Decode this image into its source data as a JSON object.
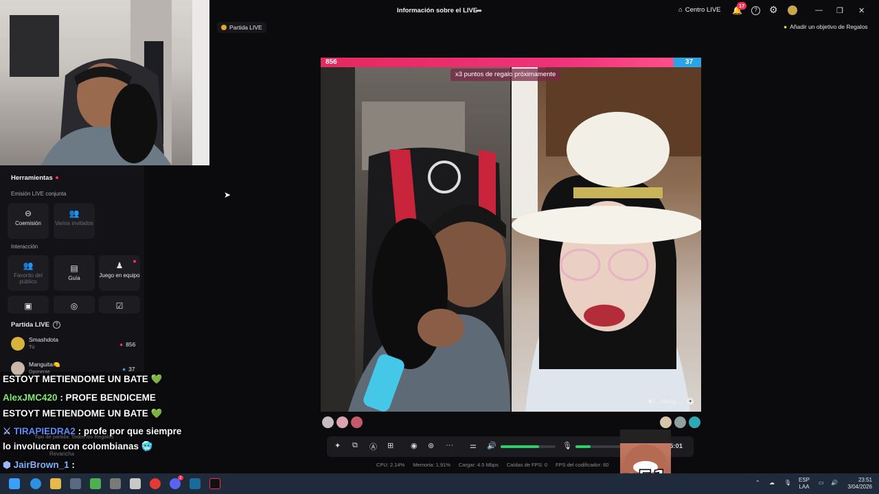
{
  "header": {
    "title": "Información sobre el LIVE",
    "centro_live": "Centro LIVE",
    "notifications_count": "17",
    "goal_label": "Añadir un objetivo de Regalos",
    "match_chip": "Partida LIVE"
  },
  "tools": {
    "title": "Herramientas",
    "section_cohost": "Emisión LIVE conjunta",
    "cohost_items": [
      {
        "label": "Coemisión",
        "enabled": true
      },
      {
        "label": "Varios invitados",
        "enabled": false
      }
    ],
    "section_interaction": "Interacción",
    "interaction_items": [
      {
        "label": "Favorito del público",
        "enabled": false
      },
      {
        "label": "Guía",
        "enabled": true
      },
      {
        "label": "Juego en equipo",
        "enabled": true
      }
    ]
  },
  "match": {
    "title": "Partida LIVE",
    "players": [
      {
        "name": "Smashdota",
        "sub": "Tú",
        "score": "856"
      },
      {
        "name": "Manguita🍋",
        "sub": "Oponente",
        "score": "37"
      }
    ],
    "match_type": "Tipo de partida: Todos los Regalos",
    "rematch": "Revancha"
  },
  "battle": {
    "score_left": "856",
    "score_right": "37",
    "banner": "x3 puntos de regalo próximamente",
    "opponent_tag": "Mang..."
  },
  "chat": [
    {
      "user": "",
      "text": "ESTOYT METIENDOME UN BATE 💚"
    },
    {
      "user": "AlexJMC420",
      "text": ": PROFE BENDICEME"
    },
    {
      "user": "",
      "text": "ESTOYT METIENDOME UN BATE 💚"
    },
    {
      "user": "TIRAPIEDRA2",
      "text": ": profe por que siempre"
    },
    {
      "user": "",
      "text": "lo involucran con colombianas 🥶"
    },
    {
      "user": "JairBrown_1",
      "text": ":"
    }
  ],
  "controls": {
    "timer": "5:01",
    "volume_level": 0.7,
    "mic_level": 0.28
  },
  "stats": [
    "CPU: 2.14%",
    "Memoria: 1.91%",
    "Cargar: 4.5 Mbps",
    "Caídas de FPS: 0",
    "FPS del codificador: 60"
  ],
  "meme": {
    "multiplier": "x51"
  },
  "taskbar": {
    "lang_top": "ESP",
    "lang_bottom": "LAA",
    "time": "23:51",
    "date": "3/04/2026",
    "discord_badge": "2"
  },
  "colors": {
    "accent_pink": "#fe2c55",
    "score_blue": "#2ba4e6",
    "level_green": "#25d366"
  }
}
